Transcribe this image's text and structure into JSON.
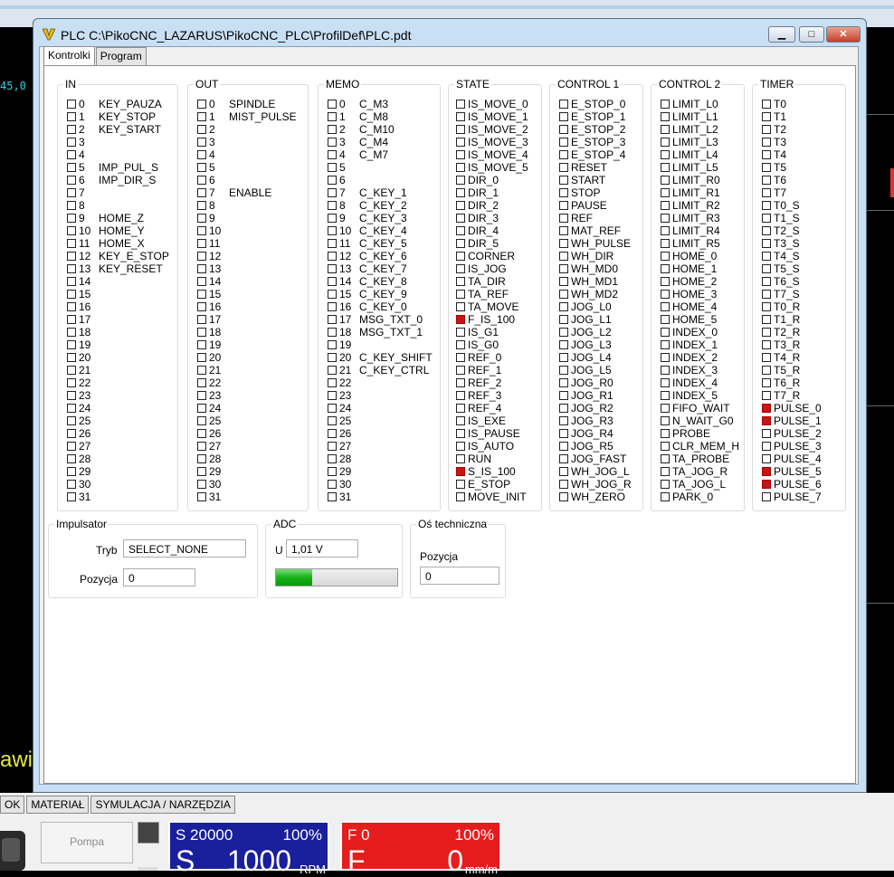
{
  "window": {
    "title": "PLC C:\\PikoCNC_LAZARUS\\PikoCNC_PLC\\ProfilDef\\PLC.pdt",
    "minimize": "▁",
    "maximize": "□",
    "close": "✕",
    "icon": "v-icon"
  },
  "tabs": [
    "Kontrolki",
    "Program"
  ],
  "groups": {
    "in": {
      "label": "IN",
      "items": [
        {
          "n": "0",
          "name": "KEY_PAUZA",
          "on": false
        },
        {
          "n": "1",
          "name": "KEY_STOP",
          "on": false
        },
        {
          "n": "2",
          "name": "KEY_START",
          "on": false
        },
        {
          "n": "3",
          "name": "",
          "on": false
        },
        {
          "n": "4",
          "name": "",
          "on": false
        },
        {
          "n": "5",
          "name": "IMP_PUL_S",
          "on": false
        },
        {
          "n": "6",
          "name": "IMP_DIR_S",
          "on": false
        },
        {
          "n": "7",
          "name": "",
          "on": false
        },
        {
          "n": "8",
          "name": "",
          "on": false
        },
        {
          "n": "9",
          "name": "HOME_Z",
          "on": false
        },
        {
          "n": "10",
          "name": "HOME_Y",
          "on": false
        },
        {
          "n": "11",
          "name": "HOME_X",
          "on": false
        },
        {
          "n": "12",
          "name": "KEY_E_STOP",
          "on": false
        },
        {
          "n": "13",
          "name": "KEY_RESET",
          "on": false
        },
        {
          "n": "14",
          "name": "",
          "on": false
        },
        {
          "n": "15",
          "name": "",
          "on": false
        },
        {
          "n": "16",
          "name": "",
          "on": false
        },
        {
          "n": "17",
          "name": "",
          "on": false
        },
        {
          "n": "18",
          "name": "",
          "on": false
        },
        {
          "n": "19",
          "name": "",
          "on": false
        },
        {
          "n": "20",
          "name": "",
          "on": false
        },
        {
          "n": "21",
          "name": "",
          "on": false
        },
        {
          "n": "22",
          "name": "",
          "on": false
        },
        {
          "n": "23",
          "name": "",
          "on": false
        },
        {
          "n": "24",
          "name": "",
          "on": false
        },
        {
          "n": "25",
          "name": "",
          "on": false
        },
        {
          "n": "26",
          "name": "",
          "on": false
        },
        {
          "n": "27",
          "name": "",
          "on": false
        },
        {
          "n": "28",
          "name": "",
          "on": false
        },
        {
          "n": "29",
          "name": "",
          "on": false
        },
        {
          "n": "30",
          "name": "",
          "on": false
        },
        {
          "n": "31",
          "name": "",
          "on": false
        }
      ]
    },
    "out": {
      "label": "OUT",
      "items": [
        {
          "n": "0",
          "name": "SPINDLE",
          "on": false
        },
        {
          "n": "1",
          "name": "MIST_PULSE",
          "on": false
        },
        {
          "n": "2",
          "name": "",
          "on": false
        },
        {
          "n": "3",
          "name": "",
          "on": false
        },
        {
          "n": "4",
          "name": "",
          "on": false
        },
        {
          "n": "5",
          "name": "",
          "on": false
        },
        {
          "n": "6",
          "name": "",
          "on": false
        },
        {
          "n": "7",
          "name": "ENABLE",
          "on": false
        },
        {
          "n": "8",
          "name": "",
          "on": false
        },
        {
          "n": "9",
          "name": "",
          "on": false
        },
        {
          "n": "10",
          "name": "",
          "on": false
        },
        {
          "n": "11",
          "name": "",
          "on": false
        },
        {
          "n": "12",
          "name": "",
          "on": false
        },
        {
          "n": "13",
          "name": "",
          "on": false
        },
        {
          "n": "14",
          "name": "",
          "on": false
        },
        {
          "n": "15",
          "name": "",
          "on": false
        },
        {
          "n": "16",
          "name": "",
          "on": false
        },
        {
          "n": "17",
          "name": "",
          "on": false
        },
        {
          "n": "18",
          "name": "",
          "on": false
        },
        {
          "n": "19",
          "name": "",
          "on": false
        },
        {
          "n": "20",
          "name": "",
          "on": false
        },
        {
          "n": "21",
          "name": "",
          "on": false
        },
        {
          "n": "22",
          "name": "",
          "on": false
        },
        {
          "n": "23",
          "name": "",
          "on": false
        },
        {
          "n": "24",
          "name": "",
          "on": false
        },
        {
          "n": "25",
          "name": "",
          "on": false
        },
        {
          "n": "26",
          "name": "",
          "on": false
        },
        {
          "n": "27",
          "name": "",
          "on": false
        },
        {
          "n": "28",
          "name": "",
          "on": false
        },
        {
          "n": "29",
          "name": "",
          "on": false
        },
        {
          "n": "30",
          "name": "",
          "on": false
        },
        {
          "n": "31",
          "name": "",
          "on": false
        }
      ]
    },
    "memo": {
      "label": "MEMO",
      "items": [
        {
          "n": "0",
          "name": "C_M3",
          "on": false
        },
        {
          "n": "1",
          "name": "C_M8",
          "on": false
        },
        {
          "n": "2",
          "name": "C_M10",
          "on": false
        },
        {
          "n": "3",
          "name": "C_M4",
          "on": false
        },
        {
          "n": "4",
          "name": "C_M7",
          "on": false
        },
        {
          "n": "5",
          "name": "",
          "on": false
        },
        {
          "n": "6",
          "name": "",
          "on": false
        },
        {
          "n": "7",
          "name": "C_KEY_1",
          "on": false
        },
        {
          "n": "8",
          "name": "C_KEY_2",
          "on": false
        },
        {
          "n": "9",
          "name": "C_KEY_3",
          "on": false
        },
        {
          "n": "10",
          "name": "C_KEY_4",
          "on": false
        },
        {
          "n": "11",
          "name": "C_KEY_5",
          "on": false
        },
        {
          "n": "12",
          "name": "C_KEY_6",
          "on": false
        },
        {
          "n": "13",
          "name": "C_KEY_7",
          "on": false
        },
        {
          "n": "14",
          "name": "C_KEY_8",
          "on": false
        },
        {
          "n": "15",
          "name": "C_KEY_9",
          "on": false
        },
        {
          "n": "16",
          "name": "C_KEY_0",
          "on": false
        },
        {
          "n": "17",
          "name": "MSG_TXT_0",
          "on": false
        },
        {
          "n": "18",
          "name": "MSG_TXT_1",
          "on": false
        },
        {
          "n": "19",
          "name": "",
          "on": false
        },
        {
          "n": "20",
          "name": "C_KEY_SHIFT",
          "on": false
        },
        {
          "n": "21",
          "name": "C_KEY_CTRL",
          "on": false
        },
        {
          "n": "22",
          "name": "",
          "on": false
        },
        {
          "n": "23",
          "name": "",
          "on": false
        },
        {
          "n": "24",
          "name": "",
          "on": false
        },
        {
          "n": "25",
          "name": "",
          "on": false
        },
        {
          "n": "26",
          "name": "",
          "on": false
        },
        {
          "n": "27",
          "name": "",
          "on": false
        },
        {
          "n": "28",
          "name": "",
          "on": false
        },
        {
          "n": "29",
          "name": "",
          "on": false
        },
        {
          "n": "30",
          "name": "",
          "on": false
        },
        {
          "n": "31",
          "name": "",
          "on": false
        }
      ]
    },
    "state": {
      "label": "STATE",
      "items": [
        {
          "name": "IS_MOVE_0",
          "on": false
        },
        {
          "name": "IS_MOVE_1",
          "on": false
        },
        {
          "name": "IS_MOVE_2",
          "on": false
        },
        {
          "name": "IS_MOVE_3",
          "on": false
        },
        {
          "name": "IS_MOVE_4",
          "on": false
        },
        {
          "name": "IS_MOVE_5",
          "on": false
        },
        {
          "name": "DIR_0",
          "on": false
        },
        {
          "name": "DIR_1",
          "on": false
        },
        {
          "name": "DIR_2",
          "on": false
        },
        {
          "name": "DIR_3",
          "on": false
        },
        {
          "name": "DIR_4",
          "on": false
        },
        {
          "name": "DIR_5",
          "on": false
        },
        {
          "name": "CORNER",
          "on": false
        },
        {
          "name": "IS_JOG",
          "on": false
        },
        {
          "name": "TA_DIR",
          "on": false
        },
        {
          "name": "TA_REF",
          "on": false
        },
        {
          "name": "TA_MOVE",
          "on": false
        },
        {
          "name": "F_IS_100",
          "on": true
        },
        {
          "name": "IS_G1",
          "on": false
        },
        {
          "name": "IS_G0",
          "on": false
        },
        {
          "name": "REF_0",
          "on": false
        },
        {
          "name": "REF_1",
          "on": false
        },
        {
          "name": "REF_2",
          "on": false
        },
        {
          "name": "REF_3",
          "on": false
        },
        {
          "name": "REF_4",
          "on": false
        },
        {
          "name": "IS_EXE",
          "on": false
        },
        {
          "name": "IS_PAUSE",
          "on": false
        },
        {
          "name": "IS_AUTO",
          "on": false
        },
        {
          "name": "RUN",
          "on": false
        },
        {
          "name": "S_IS_100",
          "on": true
        },
        {
          "name": "E_STOP",
          "on": false
        },
        {
          "name": "MOVE_INIT",
          "on": false
        }
      ]
    },
    "control1": {
      "label": "CONTROL 1",
      "items": [
        {
          "name": "E_STOP_0",
          "on": false
        },
        {
          "name": "E_STOP_1",
          "on": false
        },
        {
          "name": "E_STOP_2",
          "on": false
        },
        {
          "name": "E_STOP_3",
          "on": false
        },
        {
          "name": "E_STOP_4",
          "on": false
        },
        {
          "name": "RESET",
          "on": false
        },
        {
          "name": "START",
          "on": false
        },
        {
          "name": "STOP",
          "on": false
        },
        {
          "name": "PAUSE",
          "on": false
        },
        {
          "name": "REF",
          "on": false
        },
        {
          "name": "MAT_REF",
          "on": false
        },
        {
          "name": "WH_PULSE",
          "on": false
        },
        {
          "name": "WH_DIR",
          "on": false
        },
        {
          "name": "WH_MD0",
          "on": false
        },
        {
          "name": "WH_MD1",
          "on": false
        },
        {
          "name": "WH_MD2",
          "on": false
        },
        {
          "name": "JOG_L0",
          "on": false
        },
        {
          "name": "JOG_L1",
          "on": false
        },
        {
          "name": "JOG_L2",
          "on": false
        },
        {
          "name": "JOG_L3",
          "on": false
        },
        {
          "name": "JOG_L4",
          "on": false
        },
        {
          "name": "JOG_L5",
          "on": false
        },
        {
          "name": "JOG_R0",
          "on": false
        },
        {
          "name": "JOG_R1",
          "on": false
        },
        {
          "name": "JOG_R2",
          "on": false
        },
        {
          "name": "JOG_R3",
          "on": false
        },
        {
          "name": "JOG_R4",
          "on": false
        },
        {
          "name": "JOG_R5",
          "on": false
        },
        {
          "name": "JOG_FAST",
          "on": false
        },
        {
          "name": "WH_JOG_L",
          "on": false
        },
        {
          "name": "WH_JOG_R",
          "on": false
        },
        {
          "name": "WH_ZERO",
          "on": false
        }
      ]
    },
    "control2": {
      "label": "CONTROL 2",
      "items": [
        {
          "name": "LIMIT_L0",
          "on": false
        },
        {
          "name": "LIMIT_L1",
          "on": false
        },
        {
          "name": "LIMIT_L2",
          "on": false
        },
        {
          "name": "LIMIT_L3",
          "on": false
        },
        {
          "name": "LIMIT_L4",
          "on": false
        },
        {
          "name": "LIMIT_L5",
          "on": false
        },
        {
          "name": "LIMIT_R0",
          "on": false
        },
        {
          "name": "LIMIT_R1",
          "on": false
        },
        {
          "name": "LIMIT_R2",
          "on": false
        },
        {
          "name": "LIMIT_R3",
          "on": false
        },
        {
          "name": "LIMIT_R4",
          "on": false
        },
        {
          "name": "LIMIT_R5",
          "on": false
        },
        {
          "name": "HOME_0",
          "on": false
        },
        {
          "name": "HOME_1",
          "on": false
        },
        {
          "name": "HOME_2",
          "on": false
        },
        {
          "name": "HOME_3",
          "on": false
        },
        {
          "name": "HOME_4",
          "on": false
        },
        {
          "name": "HOME_5",
          "on": false
        },
        {
          "name": "INDEX_0",
          "on": false
        },
        {
          "name": "INDEX_1",
          "on": false
        },
        {
          "name": "INDEX_2",
          "on": false
        },
        {
          "name": "INDEX_3",
          "on": false
        },
        {
          "name": "INDEX_4",
          "on": false
        },
        {
          "name": "INDEX_5",
          "on": false
        },
        {
          "name": "FIFO_WAIT",
          "on": false
        },
        {
          "name": "N_WAIT_G0",
          "on": false
        },
        {
          "name": "PROBE",
          "on": false
        },
        {
          "name": "CLR_MEM_H",
          "on": false
        },
        {
          "name": "TA_PROBE",
          "on": false
        },
        {
          "name": "TA_JOG_R",
          "on": false
        },
        {
          "name": "TA_JOG_L",
          "on": false
        },
        {
          "name": "PARK_0",
          "on": false
        }
      ]
    },
    "timer": {
      "label": "TIMER",
      "items": [
        {
          "name": "T0",
          "on": false
        },
        {
          "name": "T1",
          "on": false
        },
        {
          "name": "T2",
          "on": false
        },
        {
          "name": "T3",
          "on": false
        },
        {
          "name": "T4",
          "on": false
        },
        {
          "name": "T5",
          "on": false
        },
        {
          "name": "T6",
          "on": false
        },
        {
          "name": "T7",
          "on": false
        },
        {
          "name": "T0_S",
          "on": false
        },
        {
          "name": "T1_S",
          "on": false
        },
        {
          "name": "T2_S",
          "on": false
        },
        {
          "name": "T3_S",
          "on": false
        },
        {
          "name": "T4_S",
          "on": false
        },
        {
          "name": "T5_S",
          "on": false
        },
        {
          "name": "T6_S",
          "on": false
        },
        {
          "name": "T7_S",
          "on": false
        },
        {
          "name": "T0_R",
          "on": false
        },
        {
          "name": "T1_R",
          "on": false
        },
        {
          "name": "T2_R",
          "on": false
        },
        {
          "name": "T3_R",
          "on": false
        },
        {
          "name": "T4_R",
          "on": false
        },
        {
          "name": "T5_R",
          "on": false
        },
        {
          "name": "T6_R",
          "on": false
        },
        {
          "name": "T7_R",
          "on": false
        },
        {
          "name": "PULSE_0",
          "on": true
        },
        {
          "name": "PULSE_1",
          "on": true
        },
        {
          "name": "PULSE_2",
          "on": false
        },
        {
          "name": "PULSE_3",
          "on": false
        },
        {
          "name": "PULSE_4",
          "on": false
        },
        {
          "name": "PULSE_5",
          "on": true
        },
        {
          "name": "PULSE_6",
          "on": true
        },
        {
          "name": "PULSE_7",
          "on": false
        }
      ]
    }
  },
  "impulsator": {
    "label": "Impulsator",
    "tryb_label": "Tryb",
    "tryb_value": "SELECT_NONE",
    "pozycja_label": "Pozycja",
    "pozycja_value": "0"
  },
  "adc": {
    "label": "ADC",
    "u_label": "U",
    "u_value": "1,01 V",
    "level_percent": 30
  },
  "os": {
    "label": "Oś techniczna",
    "pozycja_label": "Pozycja",
    "pozycja_value": "0"
  },
  "background": {
    "coord_text": "45,0 x",
    "awi_text": "awi",
    "bottom_tabs": [
      "OK",
      "MATERIAŁ",
      "SYMULACJA / NARZĘDZIA"
    ],
    "pompa_label": "Pompa",
    "s_panel": {
      "top_left": "S 20000",
      "top_right": "100%",
      "letter": "S",
      "value": "1000",
      "unit": "RPM",
      "color": "#1a1f9b"
    },
    "f_panel": {
      "top_left": "F 0",
      "top_right": "100%",
      "letter": "F",
      "value": "0",
      "unit": "mm/m",
      "color": "#e51d1d"
    }
  },
  "colors": {
    "active_indicator": "#c81414",
    "progress": "#14b314"
  }
}
